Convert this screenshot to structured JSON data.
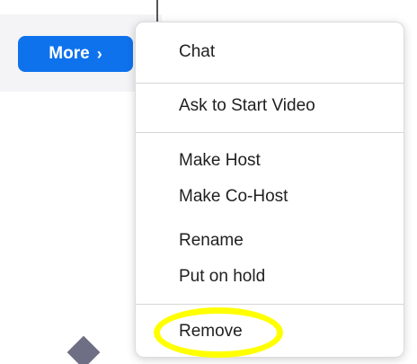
{
  "more_button": {
    "label": "More",
    "chevron": "›",
    "color": "#0e72ed"
  },
  "context_menu": {
    "items": [
      {
        "label": "Chat"
      },
      {
        "label": "Ask to Start Video"
      },
      {
        "label": "Make Host"
      },
      {
        "label": "Make Co-Host"
      },
      {
        "label": "Rename"
      },
      {
        "label": "Put on hold"
      },
      {
        "label": "Remove"
      }
    ]
  },
  "annotation": {
    "highlight_color": "#ffff00",
    "highlighted_item": "Remove"
  },
  "icons": {
    "chevron": "chevron-right-icon",
    "diamond": "diamond-icon"
  }
}
